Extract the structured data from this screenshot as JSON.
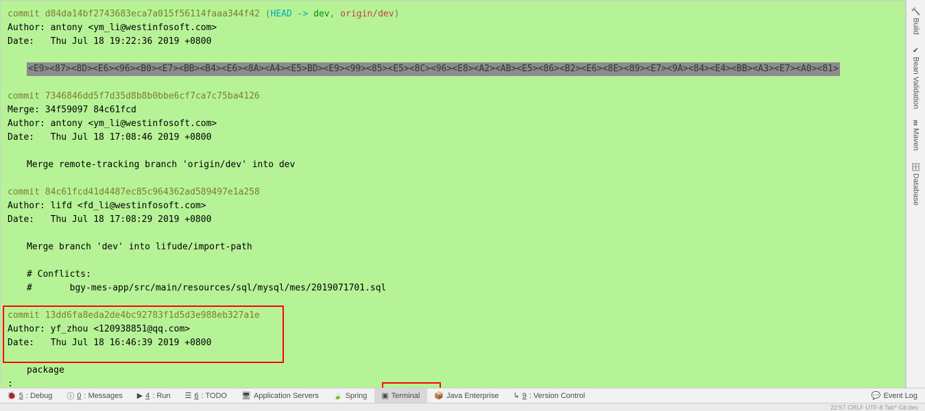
{
  "terminal": {
    "commits": [
      {
        "prefix": "commit ",
        "hash": "d84da14bf2743683eca7a015f56114faaa344f42",
        "refs": {
          "open": " (",
          "head": "HEAD -> ",
          "branch": "dev",
          "sep": ", ",
          "origin": "origin/dev",
          "close": ")"
        },
        "author": "Author: antony <ym_li@westinfosoft.com>",
        "date": "Date:   Thu Jul 18 19:22:36 2019 +0800",
        "body_selected": "<E9><87><8D><E6><96><B0><E7><BB><B4><E6><8A><A4><E5>BD><E9><99><85><E5><8C><96><E8><A2><AB><E5><86><B2><E6><8E><89><E7><9A><84><E4><BB><A3><E7><A0><81>"
      },
      {
        "prefix": "commit ",
        "hash": "7346846dd5f7d35d8b8b0bbe6cf7ca7c75ba4126",
        "merge": "Merge: 34f59097 84c61fcd",
        "author": "Author: antony <ym_li@westinfosoft.com>",
        "date": "Date:   Thu Jul 18 17:08:46 2019 +0800",
        "body": "Merge remote-tracking branch 'origin/dev' into dev"
      },
      {
        "prefix": "commit ",
        "hash": "84c61fcd41d4487ec85c964362ad589497e1a258",
        "author": "Author: lifd <fd_li@westinfosoft.com>",
        "date": "Date:   Thu Jul 18 17:08:29 2019 +0800",
        "body1": "Merge branch 'dev' into lifude/import-path",
        "body2": "# Conflicts:",
        "body3": "#       bgy-mes-app/src/main/resources/sql/mysql/mes/2019071701.sql"
      },
      {
        "prefix": "commit ",
        "hash": "13dd6fa8eda2de4bc92783f1d5d3e988eb327a1e",
        "author": "Author: yf_zhou <120938851@qq.com>",
        "date": "Date:   Thu Jul 18 16:46:39 2019 +0800",
        "body": "package"
      }
    ],
    "prompt": ":"
  },
  "sidebar": {
    "items": [
      "Build",
      "Bean Validation",
      "Maven",
      "Database"
    ],
    "maven_icon": "m"
  },
  "bottom": {
    "debug": {
      "n": "5",
      "label": ": Debug"
    },
    "messages": {
      "n": "0",
      "label": ": Messages"
    },
    "run": {
      "n": "4",
      "label": ": Run"
    },
    "todo": {
      "n": "6",
      "label": ": TODO"
    },
    "appservers": "Application Servers",
    "spring": "Spring",
    "terminal": "Terminal",
    "javaee": "Java Enterprise",
    "vcs": {
      "n": "9",
      "label": ": Version Control"
    },
    "eventlog": "Event Log"
  },
  "statusbar": {
    "text": "22:57   CRLF   UTF-8   Tab*   Git:dev"
  }
}
